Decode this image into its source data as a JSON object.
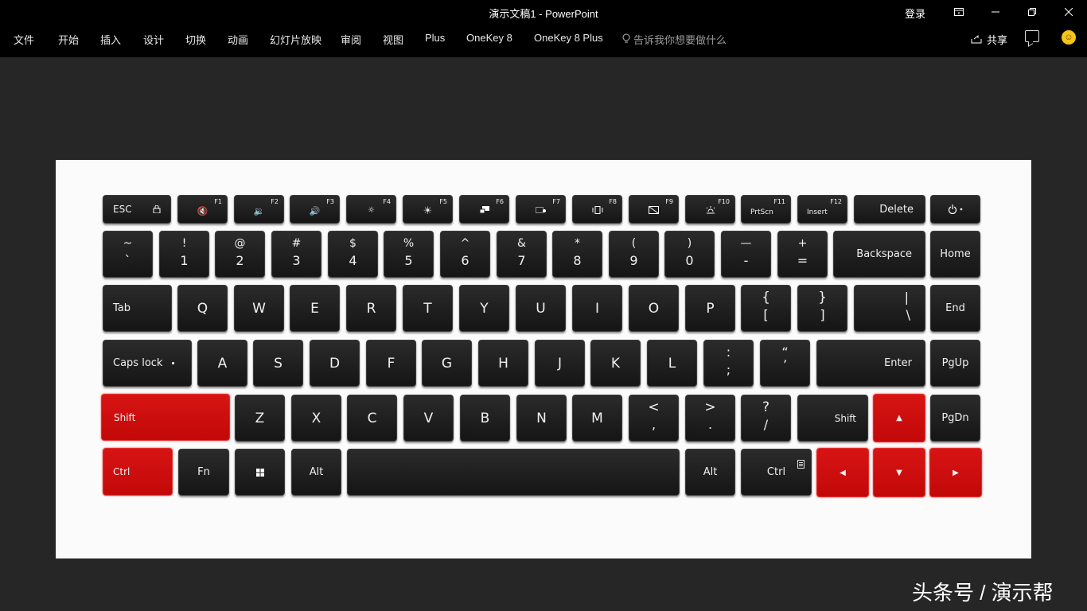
{
  "window": {
    "title": "演示文稿1  -  PowerPoint",
    "login": "登录"
  },
  "ribbon": {
    "tabs": [
      "文件",
      "开始",
      "插入",
      "设计",
      "切换",
      "动画",
      "幻灯片放映",
      "审阅",
      "视图",
      "Plus",
      "OneKey 8",
      "OneKey 8 Plus"
    ],
    "tell_me": "告诉我你想要做什么",
    "share": "共享"
  },
  "keyboard": {
    "esc": "ESC",
    "f1": "F1",
    "f2": "F2",
    "f3": "F3",
    "f4": "F4",
    "f5": "F5",
    "f6": "F6",
    "f7": "F7",
    "f8": "F8",
    "f9": "F9",
    "f10": "F10",
    "f11": "F11",
    "f12": "F12",
    "prtscn": "PrtScn",
    "insert": "Insert",
    "delete": "Delete",
    "num_top": [
      "~",
      "!",
      "@",
      "#",
      "$",
      "%",
      "^",
      "&",
      "*",
      "(",
      ")",
      "—",
      "+"
    ],
    "num_bot": [
      "`",
      "1",
      "2",
      "3",
      "4",
      "5",
      "6",
      "7",
      "8",
      "9",
      "0",
      "-",
      "="
    ],
    "backspace": "Backspace",
    "home": "Home",
    "tab": "Tab",
    "row_q": [
      "Q",
      "W",
      "E",
      "R",
      "T",
      "Y",
      "U",
      "I",
      "O",
      "P"
    ],
    "bracket_l_top": "{",
    "bracket_l_bot": "[",
    "bracket_r_top": "}",
    "bracket_r_bot": "]",
    "pipe_top": "|",
    "pipe_bot": "\\",
    "end": "End",
    "caps": "Caps lock",
    "row_a": [
      "A",
      "S",
      "D",
      "F",
      "G",
      "H",
      "J",
      "K",
      "L"
    ],
    "semi_top": ":",
    "semi_bot": ";",
    "quote_top": "“",
    "quote_bot": "’",
    "enter": "Enter",
    "pgup": "PgUp",
    "shift_l": "Shift",
    "row_z": [
      "Z",
      "X",
      "C",
      "V",
      "B",
      "N",
      "M"
    ],
    "comma_top": "<",
    "comma_bot": ",",
    "period_top": ">",
    "period_bot": ".",
    "slash_top": "?",
    "slash_bot": "/",
    "shift_r": "Shift",
    "arrow_up": "▲",
    "pgdn": "PgDn",
    "ctrl_l": "Ctrl",
    "fn": "Fn",
    "alt_l": "Alt",
    "alt_r": "Alt",
    "ctrl_r": "Ctrl",
    "arrow_left": "◀",
    "arrow_down": "▼",
    "arrow_right": "▶",
    "highlight_color": "#d10a0a"
  },
  "watermark": "头条号 / 演示帮"
}
